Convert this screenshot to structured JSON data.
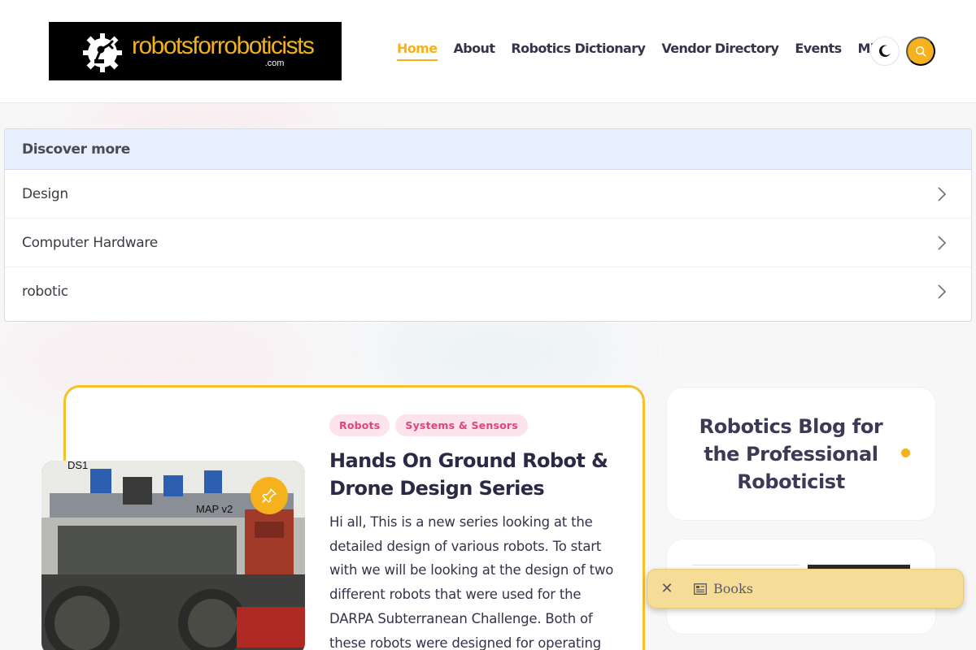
{
  "header": {
    "logo": {
      "text_part1": "robotsfor",
      "text_part2": "roboticists",
      "domain": ".com"
    },
    "nav": [
      {
        "label": "Home",
        "active": true
      },
      {
        "label": "About",
        "active": false
      },
      {
        "label": "Robotics Dictionary",
        "active": false
      },
      {
        "label": "Vendor Directory",
        "active": false
      },
      {
        "label": "Events",
        "active": false
      },
      {
        "label": "Misc",
        "active": false
      }
    ],
    "theme_toggle_icon": "moon-icon",
    "search_icon": "search-icon"
  },
  "discover": {
    "heading": "Discover more",
    "items": [
      {
        "label": "Design"
      },
      {
        "label": "Computer Hardware"
      },
      {
        "label": "robotic"
      }
    ]
  },
  "featured_post": {
    "tags": [
      "Robots",
      "Systems & Sensors"
    ],
    "title": "Hands On Ground Robot & Drone Design Series",
    "excerpt": "Hi all, This is a new series looking at the detailed design of various robots. To start with we will be looking at the design of two different robots that were used for the DARPA Subterranean Challenge. Both of these robots were designed for operating",
    "image_labels": {
      "left": "DS1",
      "right": "MAP v2"
    },
    "pin_icon": "pin-icon"
  },
  "sidebar": {
    "title": "Robotics Blog for the Professional Roboticist"
  },
  "books_popup": {
    "label": "Books",
    "close_label": "✕"
  },
  "colors": {
    "accent": "#f5b21c",
    "tag_bg": "#fde3ec",
    "tag_text": "#e0457a",
    "discover_head_bg": "#e8effc",
    "popup_bg": "#f6dd97"
  }
}
